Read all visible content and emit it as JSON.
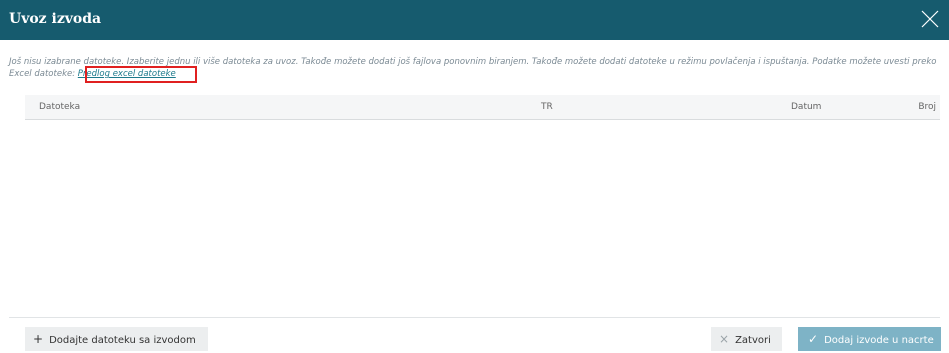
{
  "dialog": {
    "title": "Uvoz izvoda",
    "close_icon": "close-icon"
  },
  "info": {
    "text": "Još nisu izabrane datoteke. Izaberite jednu ili više datoteka za uvoz. Takođe možete dodati još fajlova ponovnim biranjem. Takođe možete dodati datoteke u režimu povlačenja i ispuštanja. Podatke možete uvesti preko Excel datoteke: ",
    "link_label": "Predlog excel datoteke"
  },
  "table": {
    "columns": [
      "Datoteka",
      "TR",
      "Datum",
      "Broj"
    ],
    "rows": []
  },
  "footer": {
    "add_file_label": "Dodajte datoteku sa izvodom",
    "close_label": "Zatvori",
    "submit_label": "Dodaj izvode u nacrte"
  },
  "colors": {
    "header_bg": "#165b6e",
    "link": "#1d7a8c",
    "primary_button": "#7eb3c6",
    "highlight": "#e02020"
  }
}
